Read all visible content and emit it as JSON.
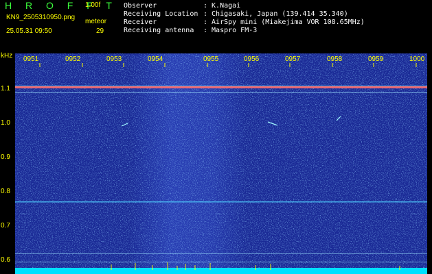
{
  "header": {
    "title": "H R O F F T",
    "version": "1.00f",
    "filename": "KN9_2505310950.png",
    "meteor_label": "meteor",
    "datetime": "25.05.31 09:50",
    "meteor_count": "29"
  },
  "info": [
    {
      "key": "Observer",
      "value": ": K.Nagai"
    },
    {
      "key": "Receiving Location",
      "value": ": Chigasaki, Japan (139.414 35.340)"
    },
    {
      "key": "Receiver",
      "value": ": AirSpy mini (Miakejima VOR 108.65MHz)"
    },
    {
      "key": "Receiving antenna",
      "value": ": Maspro FM-3"
    }
  ],
  "axis": {
    "y_unit": "kHz",
    "y_ticks": [
      "1.1",
      "1.0",
      "0.9",
      "0.8",
      "0.7",
      "0.6"
    ],
    "x_ticks": [
      "0951",
      "0952",
      "0953",
      "0954",
      "0955",
      "0956",
      "0957",
      "0958",
      "0959",
      "1000"
    ]
  },
  "colors": {
    "background": "#000000",
    "spectrum_base": "#1a2a96",
    "header_text": "#ffff00",
    "title_text": "#3cff3c",
    "info_text": "#ffffff",
    "carrier_line": "#ff6a6a",
    "bottom_band": "#00e0ff"
  }
}
